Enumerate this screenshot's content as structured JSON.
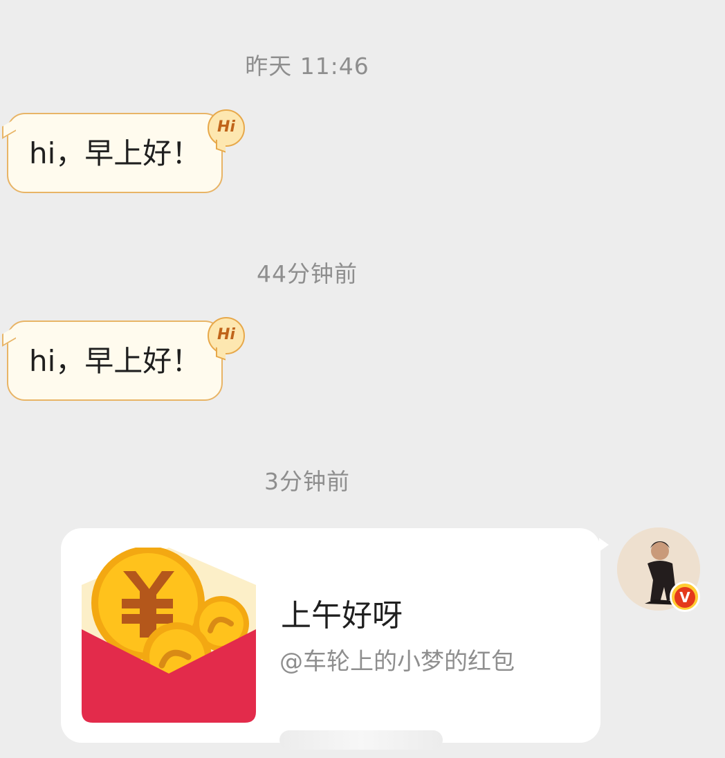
{
  "messages": {
    "ts1": "昨天 11:46",
    "greet1": "hi，早上好！",
    "ts2": "44分钟前",
    "greet2": "hi，早上好！",
    "ts3": "3分钟前"
  },
  "badge": {
    "hi_label": "Hi",
    "verified_label": "V"
  },
  "red_packet": {
    "title": "上午好呀",
    "subtitle": "@车轮上的小梦的红包",
    "icon": "red-packet-icon"
  },
  "colors": {
    "background": "#ededed",
    "greeting_bubble": "#fffbee",
    "greeting_border": "#e8b466",
    "packet_red": "#e32b4b",
    "coin_gold": "#ffc21c"
  }
}
